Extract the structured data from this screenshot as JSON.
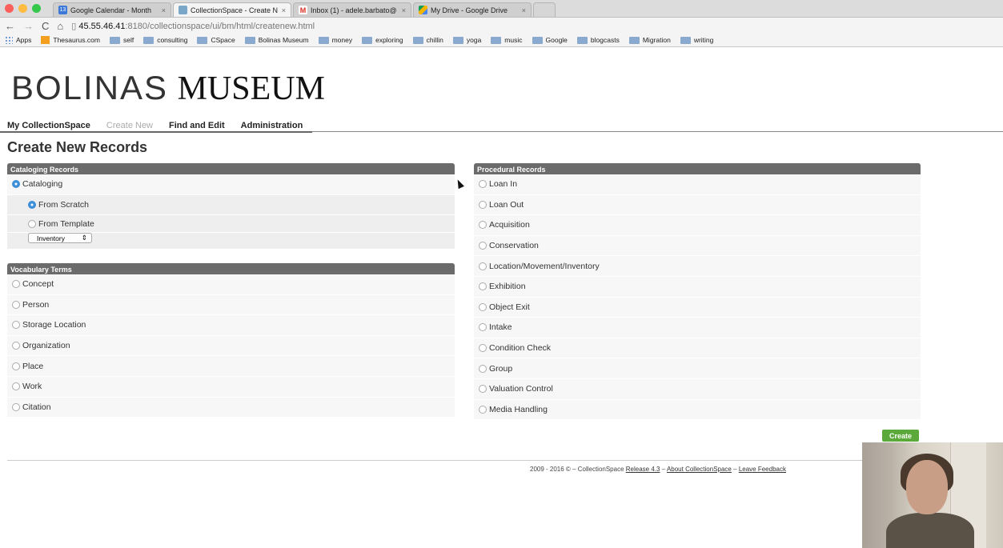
{
  "browser": {
    "tabs": [
      {
        "title": "Google Calendar - Month",
        "favicon": "13",
        "color": "#3b78d8"
      },
      {
        "title": "CollectionSpace - Create N",
        "favicon": "",
        "color": "#7aa7c7"
      },
      {
        "title": "Inbox (1) - adele.barbato@",
        "favicon": "M",
        "color": "#d93025"
      },
      {
        "title": "My Drive - Google Drive",
        "favicon": "",
        "color": "#f4b400"
      }
    ],
    "url_host": "45.55.46.41",
    "url_path": ":8180/collectionspace/ui/bm/html/createnew.html",
    "bookmarks": [
      "Apps",
      "Thesaurus.com",
      "self",
      "consulting",
      "CSpace",
      "Bolinas Museum",
      "money",
      "exploring",
      "chillin",
      "yoga",
      "music",
      "Google",
      "blogcasts",
      "Migration",
      "writing"
    ]
  },
  "logo": {
    "part1": "BOLINAS",
    "part2": "MUSEUM"
  },
  "nav": {
    "my_cspace": "My CollectionSpace",
    "create_new": "Create New",
    "find_edit": "Find and Edit",
    "admin": "Administration"
  },
  "page": {
    "title": "Create New Records"
  },
  "cataloging": {
    "header": "Cataloging Records",
    "item": "Cataloging",
    "from_scratch": "From Scratch",
    "from_template": "From Template",
    "template_value": "Inventory"
  },
  "vocabulary": {
    "header": "Vocabulary Terms",
    "items": [
      "Concept",
      "Person",
      "Storage Location",
      "Organization",
      "Place",
      "Work",
      "Citation"
    ]
  },
  "procedural": {
    "header": "Procedural Records",
    "items": [
      "Loan In",
      "Loan Out",
      "Acquisition",
      "Conservation",
      "Location/Movement/Inventory",
      "Exhibition",
      "Object Exit",
      "Intake",
      "Condition Check",
      "Group",
      "Valuation Control",
      "Media Handling"
    ]
  },
  "create_label": "Create",
  "footer": {
    "copyright": "2009 - 2016 © – CollectionSpace",
    "release": "Release 4.3",
    "sep": "–",
    "about": "About CollectionSpace",
    "feedback": "Leave Feedback"
  }
}
